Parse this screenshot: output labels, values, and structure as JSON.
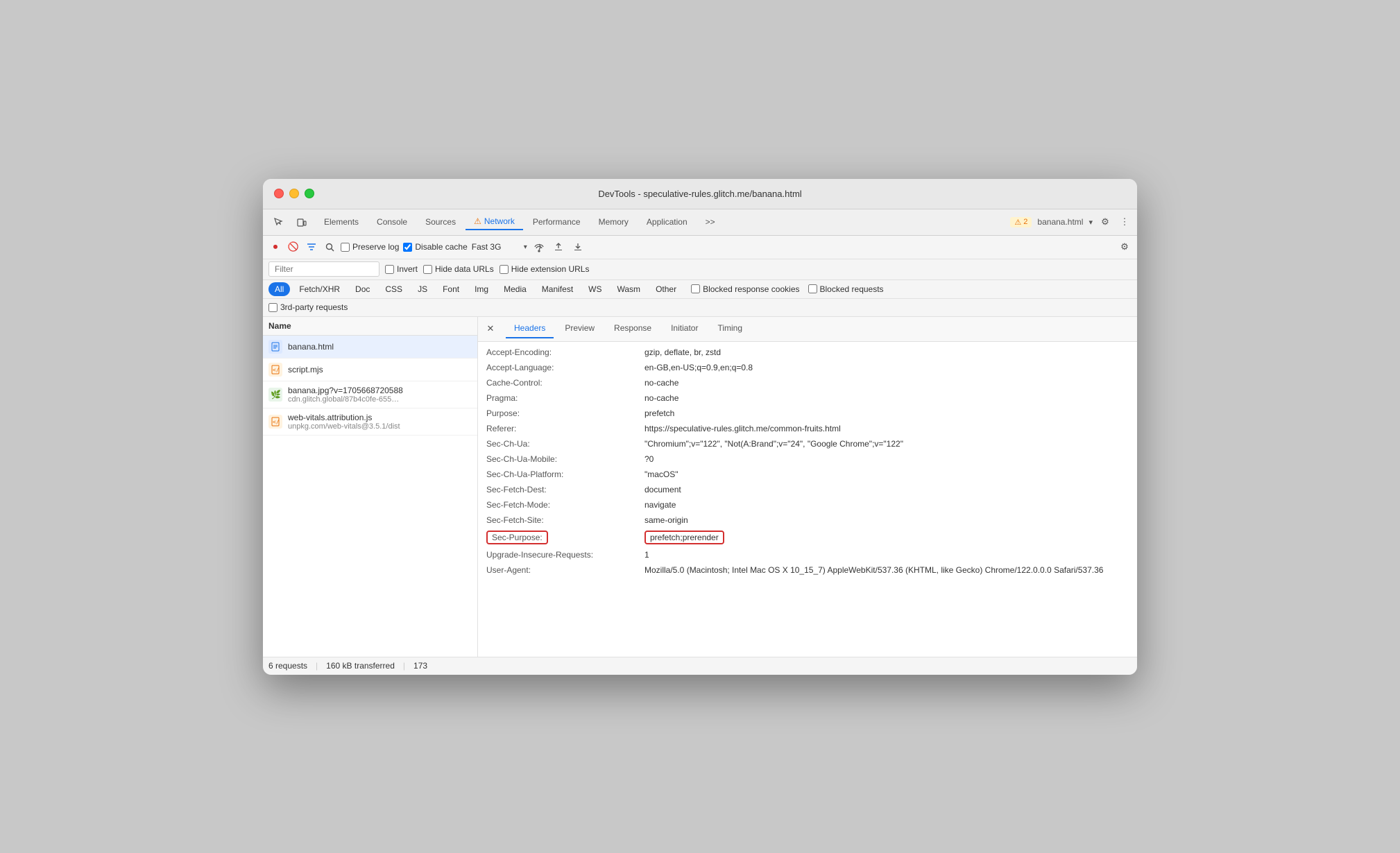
{
  "window": {
    "title": "DevTools - speculative-rules.glitch.me/banana.html"
  },
  "devtools_tabs": {
    "items": [
      "Elements",
      "Console",
      "Sources",
      "Network",
      "Performance",
      "Memory",
      "Application",
      ">>"
    ],
    "active": "Network",
    "warning_tab": "Network",
    "badge_count": "2",
    "active_file": "banana.html",
    "gear_icon": "⚙",
    "more_icon": "⋮"
  },
  "toolbar": {
    "preserve_log_label": "Preserve log",
    "disable_cache_label": "Disable cache",
    "throttle_value": "Fast 3G"
  },
  "filter_bar": {
    "filter_placeholder": "Filter",
    "invert_label": "Invert",
    "hide_data_urls_label": "Hide data URLs",
    "hide_extension_urls_label": "Hide extension URLs"
  },
  "pills": {
    "items": [
      "All",
      "Fetch/XHR",
      "Doc",
      "CSS",
      "JS",
      "Font",
      "Img",
      "Media",
      "Manifest",
      "WS",
      "Wasm",
      "Other"
    ],
    "active": "All",
    "blocked_response_label": "Blocked response cookies",
    "blocked_requests_label": "Blocked requests"
  },
  "third_party_label": "3rd-party requests",
  "file_list": {
    "col_header": "Name",
    "items": [
      {
        "name": "banana.html",
        "url": "",
        "type": "html",
        "selected": true
      },
      {
        "name": "script.mjs",
        "url": "",
        "type": "js",
        "selected": false
      },
      {
        "name": "banana.jpg?v=1705668720588",
        "url": "cdn.glitch.global/87b4c0fe-655…",
        "type": "img",
        "selected": false
      },
      {
        "name": "web-vitals.attribution.js",
        "url": "unpkg.com/web-vitals@3.5.1/dist",
        "type": "js",
        "selected": false
      }
    ]
  },
  "detail_panel": {
    "tabs": [
      "Headers",
      "Preview",
      "Response",
      "Initiator",
      "Timing"
    ],
    "active_tab": "Headers",
    "headers": [
      {
        "name": "Accept-Encoding:",
        "value": "gzip, deflate, br, zstd",
        "highlighted": false
      },
      {
        "name": "Accept-Language:",
        "value": "en-GB,en-US;q=0.9,en;q=0.8",
        "highlighted": false
      },
      {
        "name": "Cache-Control:",
        "value": "no-cache",
        "highlighted": false
      },
      {
        "name": "Pragma:",
        "value": "no-cache",
        "highlighted": false
      },
      {
        "name": "Purpose:",
        "value": "prefetch",
        "highlighted": false
      },
      {
        "name": "Referer:",
        "value": "https://speculative-rules.glitch.me/common-fruits.html",
        "highlighted": false
      },
      {
        "name": "Sec-Ch-Ua:",
        "value": "\"Chromium\";v=\"122\", \"Not(A:Brand\";v=\"24\", \"Google Chrome\";v=\"122\"",
        "highlighted": false
      },
      {
        "name": "Sec-Ch-Ua-Mobile:",
        "value": "?0",
        "highlighted": false
      },
      {
        "name": "Sec-Ch-Ua-Platform:",
        "value": "\"macOS\"",
        "highlighted": false
      },
      {
        "name": "Sec-Fetch-Dest:",
        "value": "document",
        "highlighted": false
      },
      {
        "name": "Sec-Fetch-Mode:",
        "value": "navigate",
        "highlighted": false
      },
      {
        "name": "Sec-Fetch-Site:",
        "value": "same-origin",
        "highlighted": false
      },
      {
        "name": "Sec-Purpose:",
        "value": "prefetch;prerender",
        "highlighted": true
      },
      {
        "name": "Upgrade-Insecure-Requests:",
        "value": "1",
        "highlighted": false
      },
      {
        "name": "User-Agent:",
        "value": "Mozilla/5.0 (Macintosh; Intel Mac OS X 10_15_7) AppleWebKit/537.36 (KHTML, like Gecko) Chrome/122.0.0.0 Safari/537.36",
        "highlighted": false
      }
    ]
  },
  "statusbar": {
    "requests": "6 requests",
    "transferred": "160 kB transferred",
    "size": "173"
  },
  "colors": {
    "active_tab": "#1a73e8",
    "warning": "#e8710a",
    "highlight_border": "#d32f2f",
    "selected_bg": "#e8f0fe"
  }
}
